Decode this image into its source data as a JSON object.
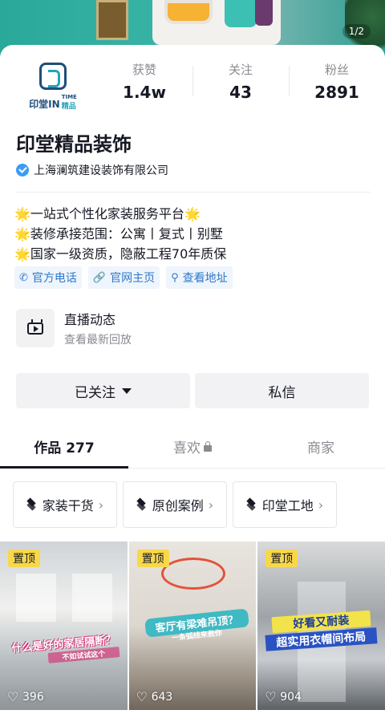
{
  "banner": {
    "page_indicator": "1/2"
  },
  "avatar": {
    "brand_name": "印堂IN",
    "brand_time": "TIME",
    "brand_sub": "精品"
  },
  "stats": [
    {
      "label": "获赞",
      "value": "1.4w"
    },
    {
      "label": "关注",
      "value": "43"
    },
    {
      "label": "粉丝",
      "value": "2891"
    }
  ],
  "profile": {
    "name": "印堂精品装饰",
    "company": "上海澜筑建设装饰有限公司",
    "bio": [
      "一站式个性化家装服务平台",
      "装修承接范围：公寓丨复式丨别墅",
      "国家一级资质，隐蔽工程70年质保"
    ],
    "bio_star": "🌟"
  },
  "links": [
    {
      "icon": "phone-icon",
      "label": "官方电话"
    },
    {
      "icon": "link-icon",
      "label": "官网主页"
    },
    {
      "icon": "location-icon",
      "label": "查看地址"
    }
  ],
  "live": {
    "title": "直播动态",
    "subtitle": "查看最新回放"
  },
  "actions": {
    "follow_label": "已关注",
    "message_label": "私信"
  },
  "tabs": [
    {
      "label": "作品 277"
    },
    {
      "label": "喜欢"
    },
    {
      "label": "商家"
    }
  ],
  "categories": [
    {
      "label": "家装干货"
    },
    {
      "label": "原创案例"
    },
    {
      "label": "印堂工地"
    }
  ],
  "videos": [
    {
      "badge": "置顶",
      "overlay": "什么是好的家居隔断？",
      "overlay_sub": "不如试试这个",
      "likes": "396"
    },
    {
      "badge": "置顶",
      "overlay": "客厅有梁难吊顶？",
      "overlay_sub": "一条弧线来救你",
      "likes": "643"
    },
    {
      "badge": "置顶",
      "overlay": "好看又耐装",
      "overlay_sub": "超实用衣帽间布局",
      "likes": "904"
    }
  ],
  "colors": {
    "accent_blue": "#2f77c9",
    "verify_blue": "#3b9cf4",
    "pin_yellow": "#f8d84a"
  }
}
